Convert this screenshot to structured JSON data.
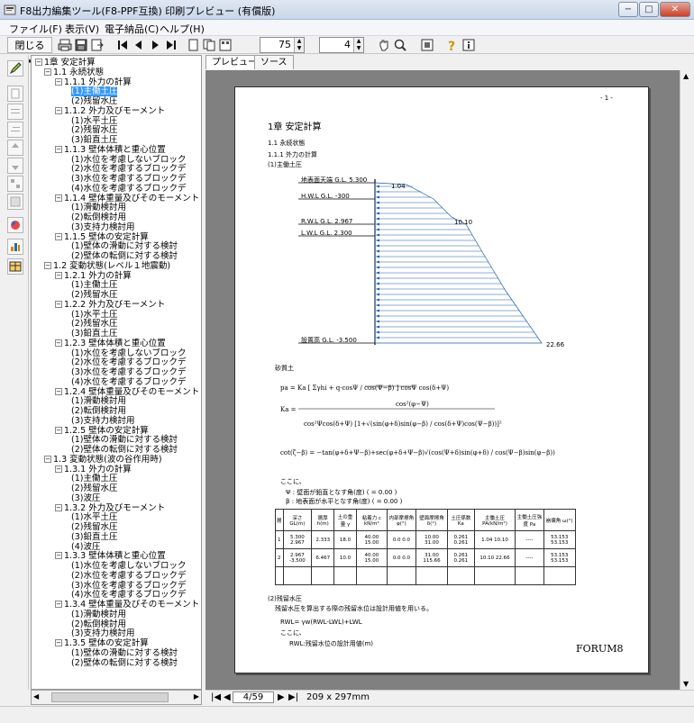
{
  "window": {
    "title": "F8出力編集ツール(F8-PPF互換) 印刷プレビュー (有償版)",
    "minimize": "−",
    "maximize": "□",
    "close": "✕"
  },
  "menu": [
    "ファイル(F)",
    "表示(V)",
    "電子納品(C)",
    "ヘルプ(H)"
  ],
  "toolbar": {
    "close_label": "閉じる(X)",
    "zoom_value": "75",
    "page_value": "4"
  },
  "tabs": [
    "プレビュー",
    "ソース"
  ],
  "tree": [
    {
      "label": "1章 安定計算",
      "level": 0,
      "exp": "−"
    },
    {
      "label": "1.1 永続状態",
      "level": 1,
      "exp": "−"
    },
    {
      "label": "1.1.1 外力の計算",
      "level": 2,
      "exp": "−"
    },
    {
      "label": "(1)主働土圧",
      "level": 3,
      "selected": true
    },
    {
      "label": "(2)残留水圧",
      "level": 3
    },
    {
      "label": "1.1.2 外力及びモーメント",
      "level": 2,
      "exp": "−"
    },
    {
      "label": "(1)水平土圧",
      "level": 3
    },
    {
      "label": "(2)残留水圧",
      "level": 3
    },
    {
      "label": "(3)鉛直土圧",
      "level": 3
    },
    {
      "label": "1.1.3 壁体体積と重心位置",
      "level": 2,
      "exp": "−"
    },
    {
      "label": "(1)水位を考慮しないブロック",
      "level": 3
    },
    {
      "label": "(2)水位を考慮するブロックデ",
      "level": 3
    },
    {
      "label": "(3)水位を考慮するブロックデ",
      "level": 3
    },
    {
      "label": "(4)水位を考慮するブロックデ",
      "level": 3
    },
    {
      "label": "1.1.4 壁体重量及びそのモーメント",
      "level": 2,
      "exp": "−"
    },
    {
      "label": "(1)滑動検討用",
      "level": 3
    },
    {
      "label": "(2)転倒検討用",
      "level": 3
    },
    {
      "label": "(3)支持力検討用",
      "level": 3
    },
    {
      "label": "1.1.5 壁体の安定計算",
      "level": 2,
      "exp": "−"
    },
    {
      "label": "(1)壁体の滑動に対する検討",
      "level": 3
    },
    {
      "label": "(2)壁体の転倒に対する検討",
      "level": 3
    },
    {
      "label": "1.2 変動状態(レベル１地震動)",
      "level": 1,
      "exp": "−"
    },
    {
      "label": "1.2.1 外力の計算",
      "level": 2,
      "exp": "−"
    },
    {
      "label": "(1)主働土圧",
      "level": 3
    },
    {
      "label": "(2)残留水圧",
      "level": 3
    },
    {
      "label": "1.2.2 外力及びモーメント",
      "level": 2,
      "exp": "−"
    },
    {
      "label": "(1)水平土圧",
      "level": 3
    },
    {
      "label": "(2)残留水圧",
      "level": 3
    },
    {
      "label": "(3)鉛直土圧",
      "level": 3
    },
    {
      "label": "1.2.3 壁体体積と重心位置",
      "level": 2,
      "exp": "−"
    },
    {
      "label": "(1)水位を考慮しないブロック",
      "level": 3
    },
    {
      "label": "(2)水位を考慮するブロックデ",
      "level": 3
    },
    {
      "label": "(3)水位を考慮するブロックデ",
      "level": 3
    },
    {
      "label": "(4)水位を考慮するブロックデ",
      "level": 3
    },
    {
      "label": "1.2.4 壁体重量及びそのモーメント",
      "level": 2,
      "exp": "−"
    },
    {
      "label": "(1)滑動検討用",
      "level": 3
    },
    {
      "label": "(2)転倒検討用",
      "level": 3
    },
    {
      "label": "(3)支持力検討用",
      "level": 3
    },
    {
      "label": "1.2.5 壁体の安定計算",
      "level": 2,
      "exp": "−"
    },
    {
      "label": "(1)壁体の滑動に対する検討",
      "level": 3
    },
    {
      "label": "(2)壁体の転倒に対する検討",
      "level": 3
    },
    {
      "label": "1.3 変動状態(波の谷作用時)",
      "level": 1,
      "exp": "−"
    },
    {
      "label": "1.3.1 外力の計算",
      "level": 2,
      "exp": "−"
    },
    {
      "label": "(1)主働土圧",
      "level": 3
    },
    {
      "label": "(2)残留水圧",
      "level": 3
    },
    {
      "label": "(3)波圧",
      "level": 3
    },
    {
      "label": "1.3.2 外力及びモーメント",
      "level": 2,
      "exp": "−"
    },
    {
      "label": "(1)水平土圧",
      "level": 3
    },
    {
      "label": "(2)残留水圧",
      "level": 3
    },
    {
      "label": "(3)鉛直土圧",
      "level": 3
    },
    {
      "label": "(4)波圧",
      "level": 3
    },
    {
      "label": "1.3.3 壁体体積と重心位置",
      "level": 2,
      "exp": "−"
    },
    {
      "label": "(1)水位を考慮しないブロック",
      "level": 3
    },
    {
      "label": "(2)水位を考慮するブロックデ",
      "level": 3
    },
    {
      "label": "(3)水位を考慮するブロックデ",
      "level": 3
    },
    {
      "label": "(4)水位を考慮するブロックデ",
      "level": 3
    },
    {
      "label": "1.3.4 壁体重量及びそのモーメント",
      "level": 2,
      "exp": "−"
    },
    {
      "label": "(1)滑動検討用",
      "level": 3
    },
    {
      "label": "(2)転倒検討用",
      "level": 3
    },
    {
      "label": "(3)支持力検討用",
      "level": 3
    },
    {
      "label": "1.3.5 壁体の安定計算",
      "level": 2,
      "exp": "−"
    },
    {
      "label": "(1)壁体の滑動に対する検討",
      "level": 3
    },
    {
      "label": "(2)壁体の転倒に対する検討",
      "level": 3
    }
  ],
  "nav": {
    "page_counter": "4/59",
    "paper_size": "209 x 297mm"
  },
  "page": {
    "page_number": "- 1 -",
    "chapter": "1章 安定計算",
    "sec": "1.1 永続状態",
    "subsec": "1.1.1 外力の計算",
    "item": "(1)主働土圧",
    "levels": [
      {
        "label": "地表面天端 G.L. 5.300"
      },
      {
        "label": "H.W.L    G.L. -300"
      },
      {
        "label": "R.W.L    G.L. 2.967"
      },
      {
        "label": "L.W.L    G.L. 2.300"
      },
      {
        "label": "設置高    G.L. -3.500"
      }
    ],
    "pressures": [
      "1.04",
      "10.10",
      "22.66"
    ],
    "sandy_soil": "砂質土",
    "eq_where": "ここに、",
    "eq_note1": "Ψ : 壁面が鉛直となす角(度) ( = 0.00 )",
    "eq_note2": "β : 地表面が水平となす角(度) ( = 0.00 )",
    "table_header": [
      "層",
      "深さ GL(m)",
      "層厚 h(m)",
      "土の重量 γ",
      "粘着力 c kN/m²",
      "内部摩擦角 φ(°)",
      "壁面摩擦角 δ(°)",
      "土圧係数 Ka",
      "主働土圧 PA(kN/m²)",
      "主働土圧強度 Pa",
      "崩壊角 ω(°)"
    ],
    "table_rows": [
      [
        "1",
        "5.300 2.967",
        "2.333",
        "18.0",
        "40.00 15.00",
        "0.0 0.0",
        "10.00 31.00",
        "0.261 0.261",
        "1.04 10.10",
        "----",
        "53.153 53.153"
      ],
      [
        "2",
        "2.967 -3.500",
        "6.467",
        "10.0",
        "40.00 15.00",
        "0.0 0.0",
        "31.00 115.66",
        "0.261 0.261",
        "10.10 22.66",
        "----",
        "53.153 53.153"
      ]
    ],
    "residual_title": "(2)残留水圧",
    "residual_text": "残留水圧を算出する際の残留水位は設計用値を用いる。",
    "residual_eq": "RWL= γw(RWL-LWL)+LWL",
    "residual_where": "ここに、",
    "residual_def": "RWL:残留水位の設計用値(m)",
    "footer_logo": "FORUM8"
  }
}
